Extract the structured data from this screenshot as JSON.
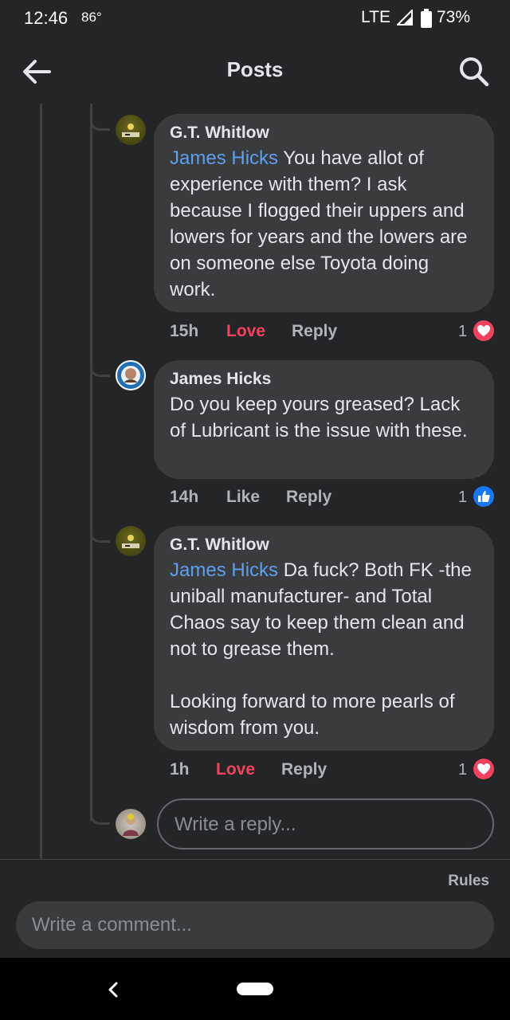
{
  "status_bar": {
    "time": "12:46",
    "temp": "86°",
    "network": "LTE",
    "battery": "73%"
  },
  "header": {
    "title": "Posts",
    "back_icon": "arrow-left-icon",
    "search_icon": "search-icon"
  },
  "comments": [
    {
      "author": "G.T. Whitlow",
      "mention": "James Hicks",
      "text": " You have allot of experience with them? I ask because I flogged their uppers and lowers for years and the lowers are on someone else Toyota doing work.",
      "time": "15h",
      "reaction_label": "Love",
      "reply_label": "Reply",
      "reaction_count": "1",
      "reaction_icon": "heart-icon"
    },
    {
      "author": "James Hicks",
      "text": "Do you keep yours greased? Lack of Lubricant is the issue with these.",
      "time": "14h",
      "reaction_label": "Like",
      "reply_label": "Reply",
      "reaction_count": "1",
      "reaction_icon": "like-icon"
    },
    {
      "author": "G.T. Whitlow",
      "mention": "James Hicks",
      "text": " Da fuck? Both FK -the uniball manufacturer- and Total Chaos say to keep them clean and not to grease them.",
      "text2": "Looking forward to more pearls of wisdom from you.",
      "time": "1h",
      "reaction_label": "Love",
      "reply_label": "Reply",
      "reaction_count": "1",
      "reaction_icon": "heart-icon"
    }
  ],
  "reply_input": {
    "placeholder": "Write a reply..."
  },
  "footer": {
    "rules": "Rules",
    "comment_placeholder": "Write a comment..."
  },
  "colors": {
    "background": "#242526",
    "bubble": "#3a3b3c",
    "mention": "#5e9ff0",
    "love": "#f3425f",
    "like": "#1877f2"
  }
}
